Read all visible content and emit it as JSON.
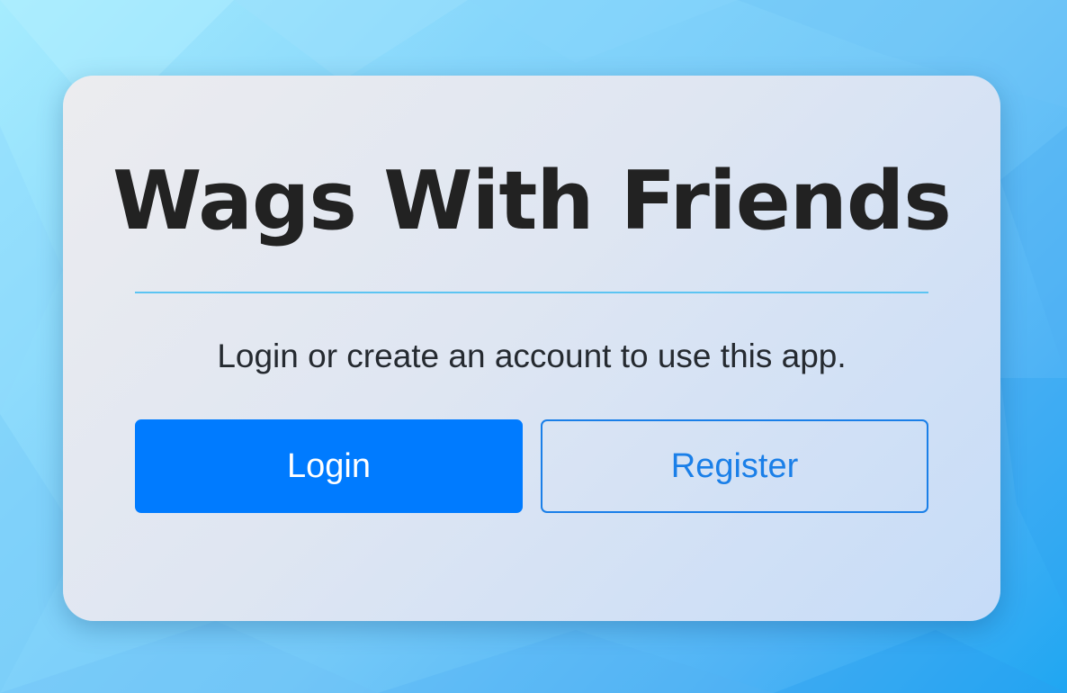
{
  "app": {
    "title": "Wags With Friends",
    "subtitle": "Login or create an account to use this app."
  },
  "actions": {
    "login_label": "Login",
    "register_label": "Register"
  },
  "colors": {
    "primary": "#007bff",
    "outline": "#1a7fe8",
    "divider": "#5cc4f2",
    "title_text": "#222222"
  }
}
